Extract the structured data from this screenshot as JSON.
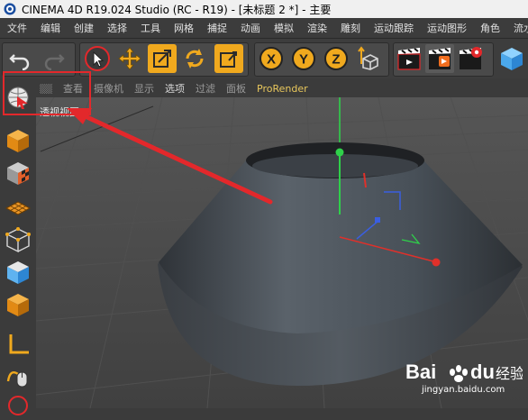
{
  "window": {
    "title": "CINEMA 4D R19.024 Studio (RC - R19) - [未标题 2 *] - 主要"
  },
  "menu": [
    "文件",
    "编辑",
    "创建",
    "选择",
    "工具",
    "网格",
    "捕捉",
    "动画",
    "模拟",
    "渲染",
    "雕刻",
    "运动跟踪",
    "运动图形",
    "角色",
    "流水线"
  ],
  "viewport_menu": [
    "查看",
    "摄像机",
    "显示",
    "选项",
    "过滤",
    "面板",
    "ProRender"
  ],
  "viewport": {
    "label": "透视视图"
  },
  "axes_buttons": {
    "x": "X",
    "y": "Y",
    "z": "Z"
  },
  "colors": {
    "accent_selected": "#f0a91e",
    "highlight": "#e3282b",
    "x_axis": "#e0302a",
    "y_axis": "#2fd04a",
    "z_axis": "#3a5ee0"
  },
  "watermark": {
    "brand": "Bai",
    "brand2": "du",
    "suffix": "经验",
    "site": "jingyan.baidu.com"
  }
}
